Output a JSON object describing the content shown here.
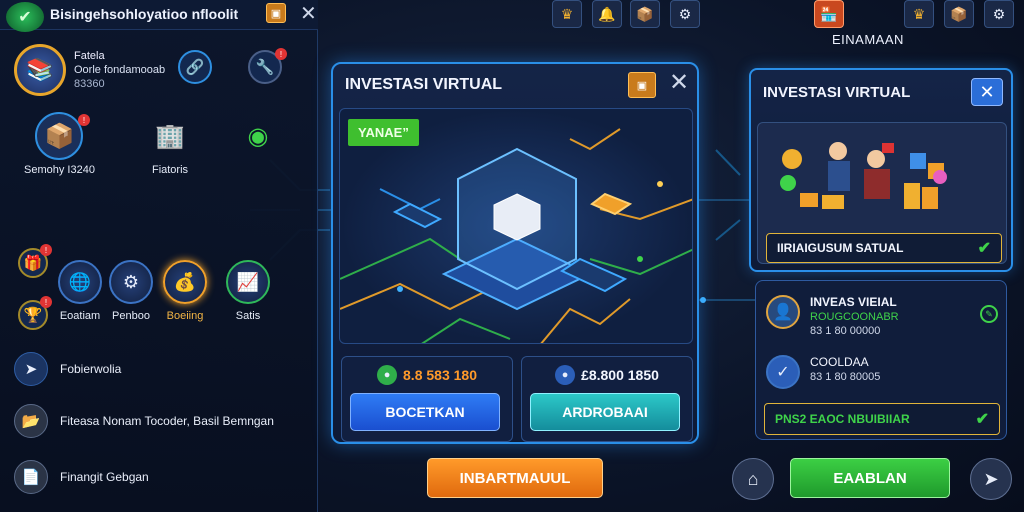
{
  "left_panel": {
    "title": "Bisingehsohloyatioo nfloolit",
    "profile": {
      "name": "Fatela",
      "subtitle": "Oorle fondamooab",
      "number": "83360"
    },
    "tiles": [
      {
        "label": "Semohy I3240",
        "icon": "cardboard-box-icon"
      },
      {
        "label": "Fiatoris",
        "icon": "building-icon"
      },
      {
        "label": "",
        "icon": "green-coin-icon"
      }
    ],
    "categories": [
      {
        "label": "Eoatiam",
        "icon": "globe-icon"
      },
      {
        "label": "Penboo",
        "icon": "machine-icon"
      },
      {
        "label": "Boeiing",
        "icon": "coin-bag-icon",
        "active": true
      },
      {
        "label": "Satis",
        "icon": "chart-icon"
      }
    ],
    "rows": [
      {
        "label": "Fobierwolia",
        "icon": "arrow-icon"
      },
      {
        "label": "Fiteasa Nonam Tocoder, Basil Bemngan",
        "icon": "folder-icon"
      },
      {
        "label": "Finangit Gebgan",
        "icon": "document-icon"
      }
    ]
  },
  "modal": {
    "title": "INVESTASI VIRTUAL",
    "tag": "YANAE”",
    "left_price": "8.8 583 180",
    "right_price": "£8.800 1850",
    "buy_button": "BOCETKAN",
    "sell_button": "ARDROBAAI",
    "main_button": "INBARTMAUUL"
  },
  "right_panel": {
    "title": "EINAMAAN",
    "card_title": "INVESTASI VIRTUAL",
    "status_label": "IIRIAIGUSUM SATUAL",
    "accounts": [
      {
        "name": "INVEAS VIEIAL",
        "line1": "ROUGCOONABR",
        "line2": "83 1 80 00000"
      },
      {
        "name": "COOLDAA",
        "line1": "",
        "line2": "83 1 80 80005"
      }
    ],
    "footer_status": "PNS2 EAOC NBUIBIIAR",
    "action_button": "EAABLAN"
  },
  "colors": {
    "accent_blue": "#2a8fe8",
    "accent_orange": "#f0a02a",
    "accent_green": "#3fd34a"
  }
}
